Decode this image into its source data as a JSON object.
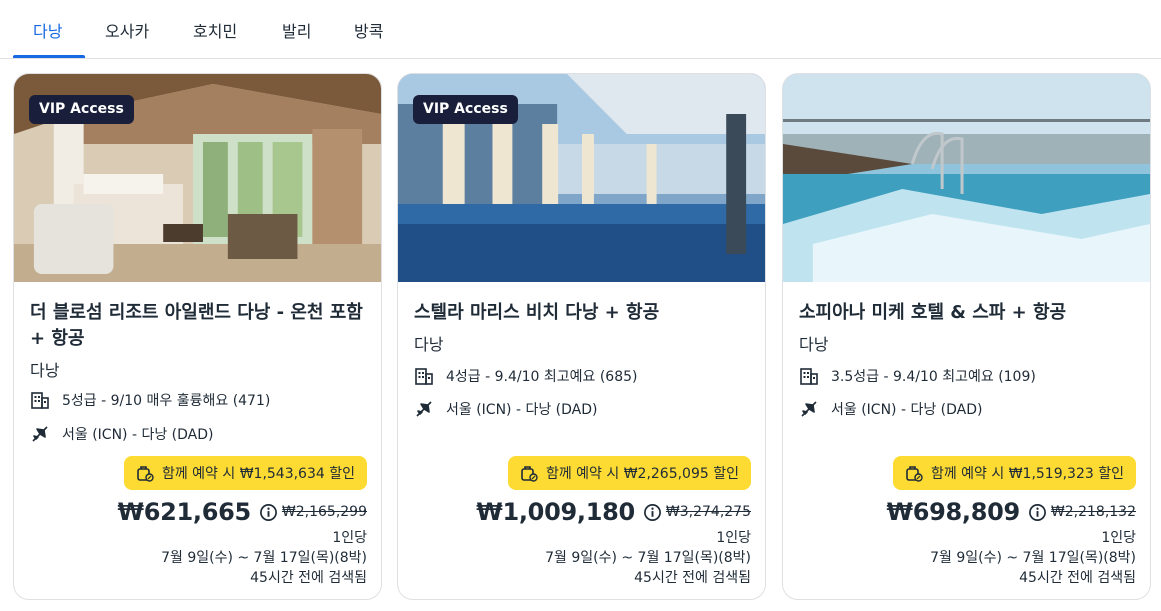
{
  "tabs": [
    {
      "label": "다낭",
      "active": true
    },
    {
      "label": "오사카",
      "active": false
    },
    {
      "label": "호치민",
      "active": false
    },
    {
      "label": "발리",
      "active": false
    },
    {
      "label": "방콕",
      "active": false
    }
  ],
  "colors": {
    "accent": "#1668e3",
    "vip_bg": "#191e3b",
    "deal_bg": "#fddb32",
    "text": "#1f2b37",
    "border": "#dfe0e4"
  },
  "cards": [
    {
      "vip_badge": "VIP Access",
      "title": "더 블로섬 리조트 아일랜드 다낭 - 온천 포함 + 항공",
      "location": "다낭",
      "rating": "5성급 - 9/10 매우 훌륭해요 (471)",
      "route": "서울 (ICN) - 다낭 (DAD)",
      "deal": "함께 예약 시 ₩1,543,634 할인",
      "price": "₩621,665",
      "old_price": "₩2,165,299",
      "per": "1인당",
      "dates": "7월 9일(수) ~ 7월 17일(목)(8박)",
      "searched": "45시간 전에 검색됨",
      "image_icon": "villa-bedroom-photo"
    },
    {
      "vip_badge": "VIP Access",
      "title": "스텔라 마리스 비치 다낭 + 항공",
      "location": "다낭",
      "rating": "4성급 - 9.4/10 최고예요 (685)",
      "route": "서울 (ICN) - 다낭 (DAD)",
      "deal": "함께 예약 시 ₩2,265,095 할인",
      "price": "₩1,009,180",
      "old_price": "₩3,274,275",
      "per": "1인당",
      "dates": "7월 9일(수) ~ 7월 17일(목)(8박)",
      "searched": "45시간 전에 검색됨",
      "image_icon": "rooftop-pool-photo"
    },
    {
      "vip_badge": "",
      "title": "소피아나 미케 호텔 & 스파 + 항공",
      "location": "다낭",
      "rating": "3.5성급 - 9.4/10 최고예요 (109)",
      "route": "서울 (ICN) - 다낭 (DAD)",
      "deal": "함께 예약 시 ₩1,519,323 할인",
      "price": "₩698,809",
      "old_price": "₩2,218,132",
      "per": "1인당",
      "dates": "7월 9일(수) ~ 7월 17일(목)(8박)",
      "searched": "45시간 전에 검색됨",
      "image_icon": "infinity-pool-photo"
    }
  ]
}
